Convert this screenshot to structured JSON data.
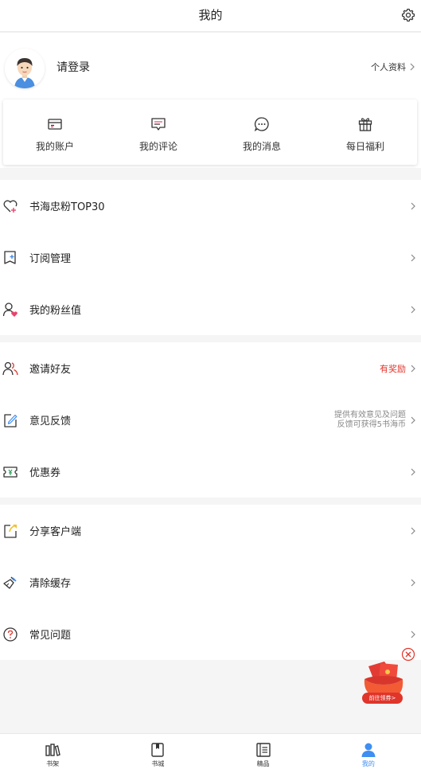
{
  "header": {
    "title": "我的"
  },
  "profile": {
    "login_label": "请登录",
    "personal_label": "个人资料"
  },
  "quick_actions": [
    {
      "label": "我的账户",
      "icon": "wallet-card-icon"
    },
    {
      "label": "我的评论",
      "icon": "comment-icon"
    },
    {
      "label": "我的消息",
      "icon": "message-bubble-icon"
    },
    {
      "label": "每日福利",
      "icon": "gift-icon"
    }
  ],
  "group1": [
    {
      "label": "书海忠粉TOP30",
      "icon": "heart-plus-icon"
    },
    {
      "label": "订阅管理",
      "icon": "subscribe-bookmark-icon"
    },
    {
      "label": "我的粉丝值",
      "icon": "user-heart-icon"
    }
  ],
  "group2": [
    {
      "label": "邀请好友",
      "icon": "users-icon",
      "badge": "有奖励"
    },
    {
      "label": "意见反馈",
      "icon": "edit-feedback-icon",
      "hint_line1": "提供有效意见及问题",
      "hint_line2": "反馈可获得5书海币"
    },
    {
      "label": "优惠券",
      "icon": "coupon-icon"
    }
  ],
  "group3": [
    {
      "label": "分享客户端",
      "icon": "share-icon"
    },
    {
      "label": "清除缓存",
      "icon": "broom-icon"
    },
    {
      "label": "常见问题",
      "icon": "question-icon"
    }
  ],
  "floating_ad": {
    "label": "前往领券>"
  },
  "tabbar": [
    {
      "label": "书架",
      "icon": "bookshelf-icon",
      "active": false
    },
    {
      "label": "书城",
      "icon": "bookstore-icon",
      "active": false
    },
    {
      "label": "精品",
      "icon": "featured-book-icon",
      "active": false
    },
    {
      "label": "我的",
      "icon": "user-icon",
      "active": true
    }
  ],
  "colors": {
    "accent_red": "#e0352b",
    "active_blue": "#3f8ef2",
    "pink": "#e8436c"
  }
}
